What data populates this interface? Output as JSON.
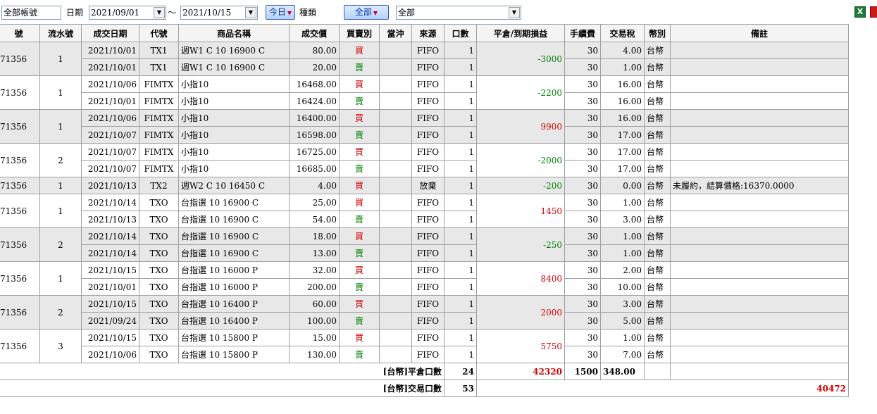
{
  "toolbar": {
    "account": "全部帳號",
    "date_label": "日期",
    "date_from": "2021/09/01",
    "tilde": "～",
    "date_to": "2021/10/15",
    "today_btn": "今日",
    "type_label": "種類",
    "type_btn": "全部",
    "type_select": "全部",
    "dropdown_arrow": "▼",
    "caret": "▼"
  },
  "columns": [
    "號",
    "流水號",
    "成交日期",
    "代號",
    "商品名稱",
    "成交價",
    "買賣別",
    "當沖",
    "來源",
    "口數",
    "平倉/到期損益",
    "手續費",
    "交易稅",
    "幣別",
    "備註"
  ],
  "groups": [
    {
      "acct": "71356",
      "serial": "1",
      "pnl": "-3000",
      "sign": "neg",
      "rows": [
        {
          "date": "2021/10/01",
          "code": "TX1",
          "name": "週W1 C 10 16900 C",
          "price": "80.00",
          "side": "買",
          "src": "FIFO",
          "qty": "1",
          "fee": "30",
          "tax": "4.00",
          "cur": "台幣",
          "note": ""
        },
        {
          "date": "2021/10/01",
          "code": "TX1",
          "name": "週W1 C 10 16900 C",
          "price": "20.00",
          "side": "賣",
          "src": "FIFO",
          "qty": "1",
          "fee": "30",
          "tax": "1.00",
          "cur": "台幣",
          "note": ""
        }
      ]
    },
    {
      "acct": "71356",
      "serial": "1",
      "pnl": "-2200",
      "sign": "neg",
      "rows": [
        {
          "date": "2021/10/06",
          "code": "FIMTX",
          "name": "小指10",
          "price": "16468.00",
          "side": "買",
          "src": "FIFO",
          "qty": "1",
          "fee": "30",
          "tax": "16.00",
          "cur": "台幣",
          "note": ""
        },
        {
          "date": "2021/10/01",
          "code": "FIMTX",
          "name": "小指10",
          "price": "16424.00",
          "side": "賣",
          "src": "FIFO",
          "qty": "1",
          "fee": "30",
          "tax": "16.00",
          "cur": "台幣",
          "note": ""
        }
      ]
    },
    {
      "acct": "71356",
      "serial": "1",
      "pnl": "9900",
      "sign": "pos",
      "rows": [
        {
          "date": "2021/10/06",
          "code": "FIMTX",
          "name": "小指10",
          "price": "16400.00",
          "side": "買",
          "src": "FIFO",
          "qty": "1",
          "fee": "30",
          "tax": "16.00",
          "cur": "台幣",
          "note": ""
        },
        {
          "date": "2021/10/07",
          "code": "FIMTX",
          "name": "小指10",
          "price": "16598.00",
          "side": "賣",
          "src": "FIFO",
          "qty": "1",
          "fee": "30",
          "tax": "17.00",
          "cur": "台幣",
          "note": ""
        }
      ]
    },
    {
      "acct": "71356",
      "serial": "2",
      "pnl": "-2000",
      "sign": "neg",
      "rows": [
        {
          "date": "2021/10/07",
          "code": "FIMTX",
          "name": "小指10",
          "price": "16725.00",
          "side": "買",
          "src": "FIFO",
          "qty": "1",
          "fee": "30",
          "tax": "17.00",
          "cur": "台幣",
          "note": ""
        },
        {
          "date": "2021/10/07",
          "code": "FIMTX",
          "name": "小指10",
          "price": "16685.00",
          "side": "賣",
          "src": "FIFO",
          "qty": "1",
          "fee": "30",
          "tax": "17.00",
          "cur": "台幣",
          "note": ""
        }
      ]
    },
    {
      "acct": "71356",
      "serial": "1",
      "pnl": "-200",
      "sign": "neg",
      "rows": [
        {
          "date": "2021/10/13",
          "code": "TX2",
          "name": "週W2 C 10 16450 C",
          "price": "4.00",
          "side": "買",
          "src": "放棄",
          "qty": "1",
          "fee": "30",
          "tax": "0.00",
          "cur": "台幣",
          "note": "未履約，結算價格:16370.0000"
        }
      ]
    },
    {
      "acct": "71356",
      "serial": "1",
      "pnl": "1450",
      "sign": "pos",
      "rows": [
        {
          "date": "2021/10/14",
          "code": "TXO",
          "name": "台指選 10 16900 C",
          "price": "25.00",
          "side": "買",
          "src": "FIFO",
          "qty": "1",
          "fee": "30",
          "tax": "1.00",
          "cur": "台幣",
          "note": ""
        },
        {
          "date": "2021/10/13",
          "code": "TXO",
          "name": "台指選 10 16900 C",
          "price": "54.00",
          "side": "賣",
          "src": "FIFO",
          "qty": "1",
          "fee": "30",
          "tax": "3.00",
          "cur": "台幣",
          "note": ""
        }
      ]
    },
    {
      "acct": "71356",
      "serial": "2",
      "pnl": "-250",
      "sign": "neg",
      "rows": [
        {
          "date": "2021/10/14",
          "code": "TXO",
          "name": "台指選 10 16900 C",
          "price": "18.00",
          "side": "買",
          "src": "FIFO",
          "qty": "1",
          "fee": "30",
          "tax": "1.00",
          "cur": "台幣",
          "note": ""
        },
        {
          "date": "2021/10/14",
          "code": "TXO",
          "name": "台指選 10 16900 C",
          "price": "13.00",
          "side": "賣",
          "src": "FIFO",
          "qty": "1",
          "fee": "30",
          "tax": "1.00",
          "cur": "台幣",
          "note": ""
        }
      ]
    },
    {
      "acct": "71356",
      "serial": "1",
      "pnl": "8400",
      "sign": "pos",
      "rows": [
        {
          "date": "2021/10/15",
          "code": "TXO",
          "name": "台指選 10 16000 P",
          "price": "32.00",
          "side": "買",
          "src": "FIFO",
          "qty": "1",
          "fee": "30",
          "tax": "2.00",
          "cur": "台幣",
          "note": ""
        },
        {
          "date": "2021/10/01",
          "code": "TXO",
          "name": "台指選 10 16000 P",
          "price": "200.00",
          "side": "賣",
          "src": "FIFO",
          "qty": "1",
          "fee": "30",
          "tax": "10.00",
          "cur": "台幣",
          "note": ""
        }
      ]
    },
    {
      "acct": "71356",
      "serial": "2",
      "pnl": "2000",
      "sign": "pos",
      "rows": [
        {
          "date": "2021/10/15",
          "code": "TXO",
          "name": "台指選 10 16400 P",
          "price": "60.00",
          "side": "買",
          "src": "FIFO",
          "qty": "1",
          "fee": "30",
          "tax": "3.00",
          "cur": "台幣",
          "note": ""
        },
        {
          "date": "2021/09/24",
          "code": "TXO",
          "name": "台指選 10 16400 P",
          "price": "100.00",
          "side": "賣",
          "src": "FIFO",
          "qty": "1",
          "fee": "30",
          "tax": "5.00",
          "cur": "台幣",
          "note": ""
        }
      ]
    },
    {
      "acct": "71356",
      "serial": "3",
      "pnl": "5750",
      "sign": "pos",
      "rows": [
        {
          "date": "2021/10/15",
          "code": "TXO",
          "name": "台指選 10 15800 P",
          "price": "15.00",
          "side": "買",
          "src": "FIFO",
          "qty": "1",
          "fee": "30",
          "tax": "1.00",
          "cur": "台幣",
          "note": ""
        },
        {
          "date": "2021/10/06",
          "code": "TXO",
          "name": "台指選 10 15800 P",
          "price": "130.00",
          "side": "賣",
          "src": "FIFO",
          "qty": "1",
          "fee": "30",
          "tax": "7.00",
          "cur": "台幣",
          "note": ""
        }
      ]
    }
  ],
  "summary": {
    "close_label": "[台幣]平倉口數",
    "close_qty": "24",
    "close_pnl": "42320",
    "close_fee": "1500",
    "close_tax": "348.00",
    "trade_label": "[台幣]交易口數",
    "trade_qty": "53",
    "net_total": "40472"
  },
  "colors": {
    "buy": "#d00000",
    "sell": "#008000",
    "alt_row": "#e8e8e8"
  }
}
